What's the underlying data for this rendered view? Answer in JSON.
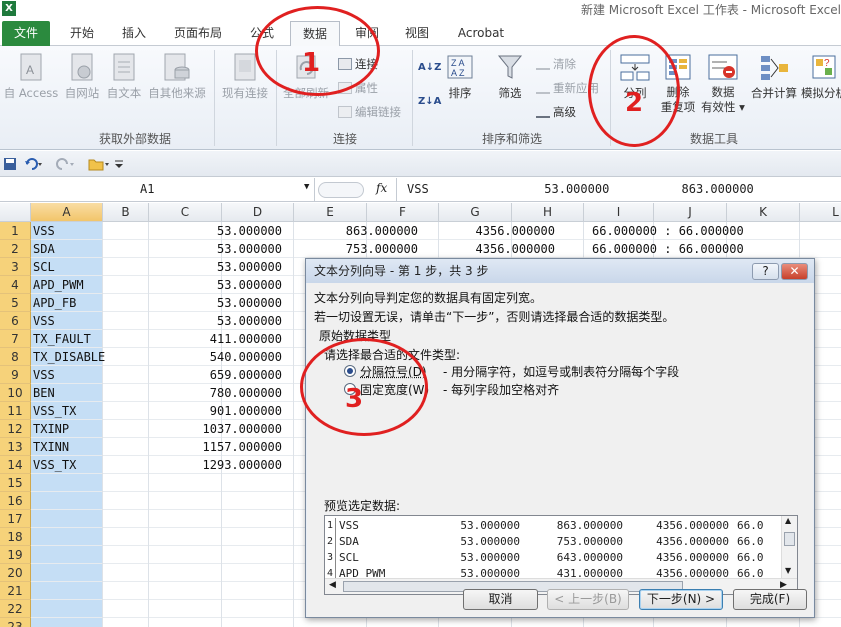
{
  "window": {
    "app_icon": "X",
    "title": "新建 Microsoft Excel 工作表 - Microsoft Excel"
  },
  "ribbon_tabs": [
    "文件",
    "开始",
    "插入",
    "页面布局",
    "公式",
    "数据",
    "审阅",
    "视图",
    "Acrobat"
  ],
  "ribbon": {
    "get_external": {
      "access": "自 Access",
      "web": "自网站",
      "text": "自文本",
      "other": "自其他来源",
      "existing": "现有连接",
      "label": "获取外部数据"
    },
    "connections": {
      "refresh_all": "全部刷新",
      "connections": "连接",
      "properties": "属性",
      "edit_links": "编辑链接",
      "label": "连接"
    },
    "sort_filter": {
      "sort": "排序",
      "filter": "筛选",
      "clear": "清除",
      "reapply": "重新应用",
      "advanced": "高级",
      "label": "排序和筛选",
      "az": "A↓Z",
      "za": "Z↓A"
    },
    "data_tools": {
      "text_to_columns": "分列",
      "remove_dupes_1": "删除",
      "remove_dupes_2": "重复项",
      "validation_1": "数据",
      "validation_2": "有效性 ▾",
      "consolidate": "合并计算",
      "whatif": "模拟分析",
      "label": "数据工具"
    }
  },
  "formula_bar": {
    "name_box": "A1",
    "fx": "fx",
    "content": "VSS                53.000000          863.000000"
  },
  "columns": [
    "A",
    "B",
    "C",
    "D",
    "E",
    "F",
    "G",
    "H",
    "I",
    "J",
    "K",
    "L"
  ],
  "rows": [
    "1",
    "2",
    "3",
    "4",
    "5",
    "6",
    "7",
    "8",
    "9",
    "10",
    "11",
    "12",
    "13",
    "14",
    "15",
    "16",
    "17",
    "18",
    "19",
    "20",
    "21",
    "22",
    "23"
  ],
  "cells": {
    "colA": [
      "VSS",
      "SDA",
      "SCL",
      "APD_PWM",
      "APD_FB",
      "VSS",
      "TX_FAULT",
      "TX_DISABLE",
      "VSS",
      "BEN",
      "VSS_TX",
      "TXINP",
      "TXINN",
      "VSS_TX"
    ],
    "colD": [
      "53.000000",
      "53.000000",
      "53.000000",
      "53.000000",
      "53.000000",
      "53.000000",
      "411.000000",
      "540.000000",
      "659.000000",
      "780.000000",
      "901.000000",
      "1037.000000",
      "1157.000000",
      "1293.000000"
    ],
    "row1_rest": {
      "E": "863.000000",
      "G": "4356.000000",
      "I": "66.000000 : 66.000000"
    },
    "row2_rest": {
      "E": "753.000000",
      "G": "4356.000000",
      "I": "66.000000 : 66.000000"
    }
  },
  "dialog": {
    "title": "文本分列向导 - 第 1 步，共 3 步",
    "help": "?",
    "close": "✕",
    "line1": "文本分列向导判定您的数据具有固定列宽。",
    "line2": "若一切设置无误，请单击“下一步”，否则请选择最合适的数据类型。",
    "group_label": "原始数据类型",
    "choose_label": "请选择最合适的文件类型:",
    "option1": "分隔符号(D)",
    "option1_desc": "- 用分隔字符，如逗号或制表符分隔每个字段",
    "option2": "固定宽度(W)",
    "option2_desc": "- 每列字段加空格对齐",
    "preview_label": "预览选定数据:",
    "preview_rows": [
      {
        "n": "1",
        "name": "VSS",
        "a": "53.000000",
        "b": "863.000000",
        "c": "4356.000000",
        "d": "66.0"
      },
      {
        "n": "2",
        "name": "SDA",
        "a": "53.000000",
        "b": "753.000000",
        "c": "4356.000000",
        "d": "66.0"
      },
      {
        "n": "3",
        "name": "SCL",
        "a": "53.000000",
        "b": "643.000000",
        "c": "4356.000000",
        "d": "66.0"
      },
      {
        "n": "4",
        "name": "APD_PWM",
        "a": "53.000000",
        "b": "431.000000",
        "c": "4356.000000",
        "d": "66.0"
      }
    ],
    "btn_cancel": "取消",
    "btn_back": "< 上一步(B)",
    "btn_next": "下一步(N) >",
    "btn_finish": "完成(F)"
  },
  "annotations": [
    "1",
    "2",
    "3"
  ],
  "colors": {
    "file_tab": "#2b8a3e",
    "selection": "#c5def5",
    "row_header": "#f6d27a",
    "annotation": "#e02020"
  }
}
